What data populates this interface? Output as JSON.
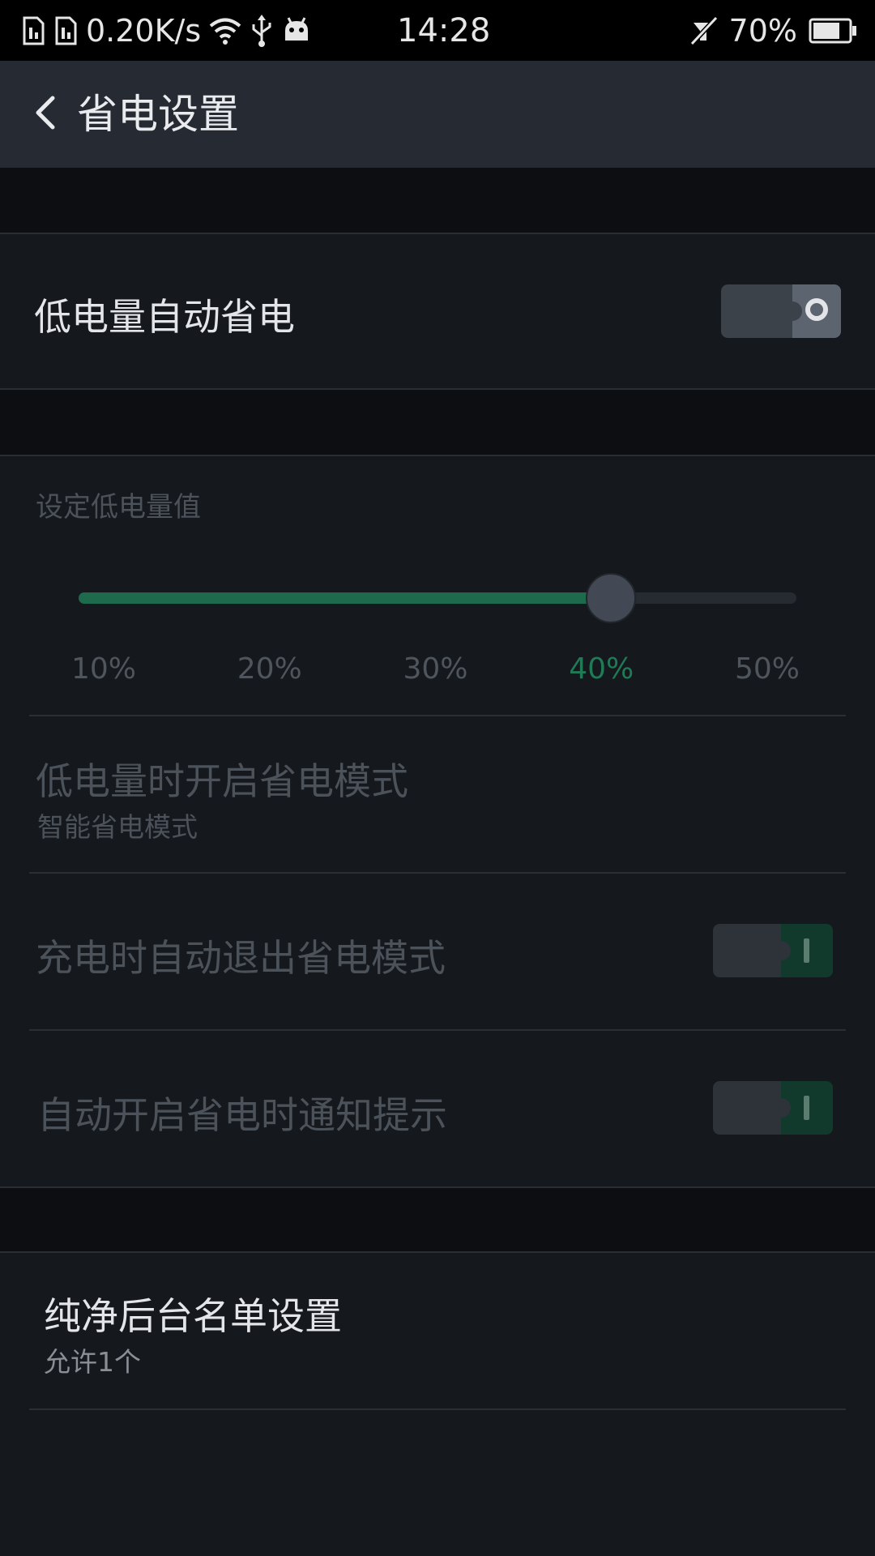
{
  "status_bar": {
    "net_speed": "0.20K/s",
    "time": "14:28",
    "battery": "70%",
    "icons": [
      "sim-card-icon",
      "sim-card-icon",
      "wifi-icon",
      "usb-icon",
      "android-icon",
      "mute-icon",
      "battery-icon"
    ]
  },
  "header": {
    "title": "省电设置"
  },
  "low_battery_auto": {
    "label": "低电量自动省电",
    "enabled": false
  },
  "threshold": {
    "label": "设定低电量值",
    "options": [
      "10%",
      "20%",
      "30%",
      "40%",
      "50%"
    ],
    "selected": "40%",
    "selected_index": 3
  },
  "mode_row": {
    "label": "低电量时开启省电模式",
    "value": "智能省电模式"
  },
  "charge_exit": {
    "label": "充电时自动退出省电模式",
    "enabled": true
  },
  "notify": {
    "label": "自动开启省电时通知提示",
    "enabled": true
  },
  "whitelist": {
    "label": "纯净后台名单设置",
    "value": "允许1个"
  },
  "colors": {
    "accent": "#1f7a55",
    "background": "#15181d",
    "header": "#262b33"
  }
}
